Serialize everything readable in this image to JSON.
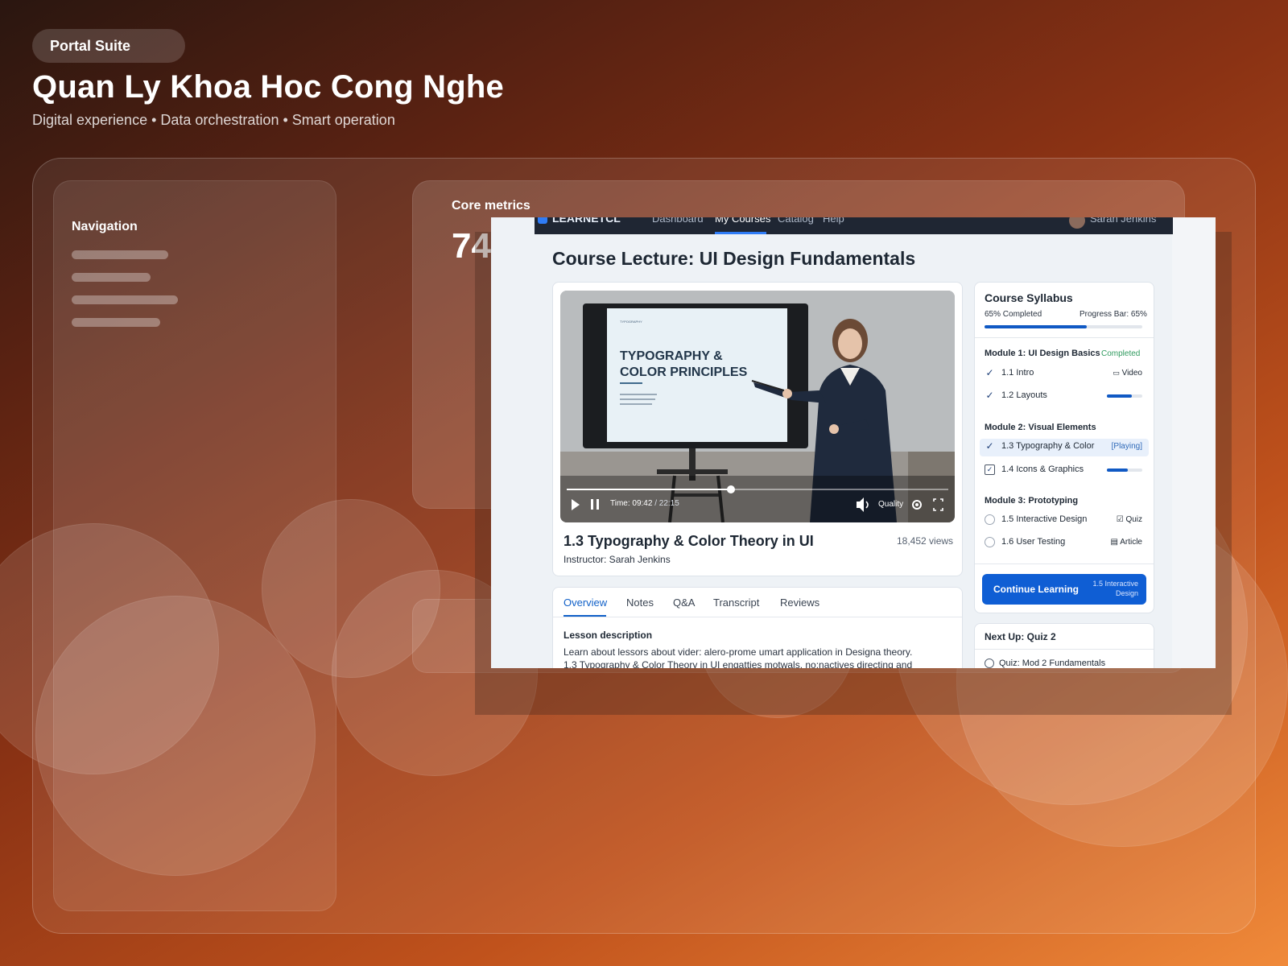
{
  "header": {
    "brand": "Portal Suite",
    "title": "Quan Ly Khoa Hoc Cong Nghe",
    "subtitle": "Digital experience • Data orchestration • Smart operation"
  },
  "navigation": {
    "title": "Navigation"
  },
  "metrics": {
    "label": "Core metrics",
    "value": "74"
  },
  "app": {
    "logo": "LEARNETCL",
    "nav": [
      "Dashboard",
      "My Courses",
      "Catalog",
      "Help"
    ],
    "active_nav": "My Courses",
    "user": "Sarah Jenkins"
  },
  "lecture": {
    "page_title": "Course Lecture: UI Design Fundamentals",
    "slide_title_line1": "TYPOGRAPHY &",
    "slide_title_line2": "COLOR PRINCIPLES",
    "player": {
      "time_label": "Time: 09:42",
      "duration": "/ 22:15",
      "quality": "Quality",
      "progress": 0.43
    },
    "video_title": "1.3 Typography & Color Theory in UI",
    "views": "18,452 views",
    "instructor": "Instructor: Sarah Jenkins"
  },
  "tabs": [
    "Overview",
    "Notes",
    "Q&A",
    "Transcript",
    "Reviews"
  ],
  "active_tab": "Overview",
  "lesson": {
    "heading": "Lesson description",
    "text": "Learn about lessors about vider: alero-prome umart application in Designa theory. 1.3 Typography & Color Theory in UI engatties motwals, no:nactives directing and how at"
  },
  "syllabus": {
    "title": "Course Syllabus",
    "completed": "65% Completed",
    "progress_label": "Progress Bar: 65%",
    "progress": 0.65,
    "modules": [
      {
        "title": "Module 1: UI Design Basics",
        "status": "Completed"
      },
      {
        "title": "Module 2: Visual Elements"
      },
      {
        "title": "Module 3: Prototyping"
      }
    ],
    "items": [
      {
        "label": "1.1 Intro",
        "meta": "Video"
      },
      {
        "label": "1.2 Layouts",
        "progress": 0.7
      },
      {
        "label": "1.3 Typography & Color",
        "meta": "[Playing]"
      },
      {
        "label": "1.4 Icons & Graphics",
        "progress": 0.6
      },
      {
        "label": "1.5 Interactive Design",
        "meta": "Quiz"
      },
      {
        "label": "1.6 User Testing",
        "meta": "Article"
      }
    ],
    "cta": "Continue Learning",
    "cta_sub": "1.5 Interactive Design"
  },
  "next_up": {
    "title": "Next Up: Quiz 2",
    "item": "Quiz: Mod 2 Fundamentals"
  },
  "colors": {
    "accent": "#0f5ed4",
    "completed": "#2f9a5e",
    "dark_bar": "#1f2633"
  }
}
